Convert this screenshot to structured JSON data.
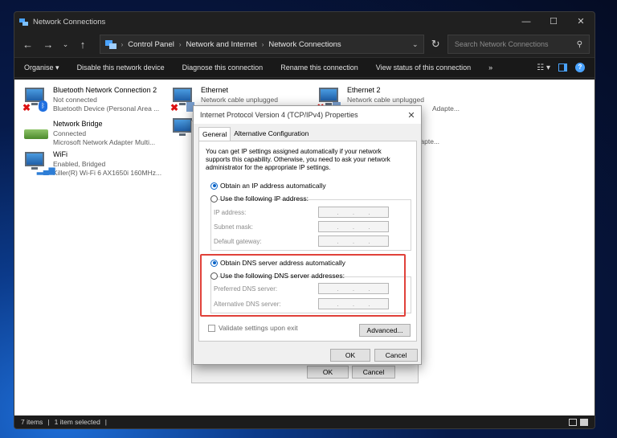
{
  "window": {
    "title": "Network Connections"
  },
  "address": {
    "crumbs": [
      "Control Panel",
      "Network and Internet",
      "Network Connections"
    ]
  },
  "search": {
    "placeholder": "Search Network Connections"
  },
  "commands": {
    "organise": "Organise",
    "disable": "Disable this network device",
    "diagnose": "Diagnose this connection",
    "rename": "Rename this connection",
    "view_status": "View status of this connection",
    "more": "»"
  },
  "connections": [
    {
      "name": "Bluetooth Network Connection 2",
      "status": "Not connected",
      "device": "Bluetooth Device (Personal Area ..."
    },
    {
      "name": "Network Bridge",
      "status": "Connected",
      "device": "Microsoft Network Adapter Multi..."
    },
    {
      "name": "WiFi",
      "status": "Enabled, Bridged",
      "device": "Killer(R) Wi-Fi 6 AX1650i 160MHz..."
    },
    {
      "name": "Ethernet",
      "status": "Network cable unplugged",
      "device": ""
    },
    {
      "name": "Ethernet 2",
      "status": "Network cable unplugged",
      "device": "Adapte..."
    }
  ],
  "bg_dialog": {
    "partial_text": "Adapte...",
    "ok": "OK",
    "cancel": "Cancel"
  },
  "dialog": {
    "title": "Internet Protocol Version 4 (TCP/IPv4) Properties",
    "close": "✕",
    "tabs": [
      "General",
      "Alternative Configuration"
    ],
    "intro": "You can get IP settings assigned automatically if your network supports this capability. Otherwise, you need to ask your network administrator for the appropriate IP settings.",
    "obtain_ip": "Obtain an IP address automatically",
    "use_ip": "Use the following IP address:",
    "ip_label": "IP address:",
    "subnet_label": "Subnet mask:",
    "gateway_label": "Default gateway:",
    "obtain_dns": "Obtain DNS server address automatically",
    "use_dns": "Use the following DNS server addresses:",
    "preferred_label": "Preferred DNS server:",
    "alternate_label": "Alternative DNS server:",
    "validate": "Validate settings upon exit",
    "advanced": "Advanced...",
    "ok": "OK",
    "cancel": "Cancel"
  },
  "status": {
    "items": "7 items",
    "selected": "1 item selected"
  }
}
